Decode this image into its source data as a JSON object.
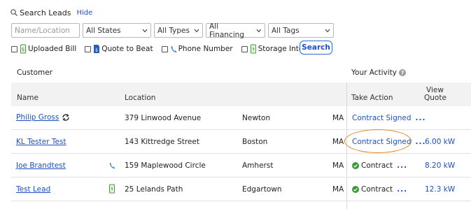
{
  "search": {
    "title": "Search Leads",
    "hide_label": "Hide",
    "name_location_placeholder": "Name/Location",
    "states_value": "All States",
    "types_value": "All Types",
    "financing_value": "All Financing",
    "tags_value": "All Tags",
    "button_label": "Search"
  },
  "checkboxes": {
    "uploaded_bill": "Uploaded Bill",
    "quote_to_beat": "Quote to Beat",
    "phone_number": "Phone Number",
    "storage_interest": "Storage Interest"
  },
  "sections": {
    "customer": "Customer",
    "your_activity": "Your Activity",
    "help_glyph": "?"
  },
  "table": {
    "headers": {
      "name": "Name",
      "location": "Location",
      "take_action": "Take Action",
      "view_quote_line1": "View",
      "view_quote_line2": "Quote"
    },
    "rows": [
      {
        "name": "Philip Gross",
        "address": "379 Linwood Avenue",
        "city": "Newton",
        "state": "MA",
        "action": "Contract Signed",
        "dots": "...",
        "quote": ""
      },
      {
        "name": "KL Tester Test",
        "address": "143 Kittredge Street",
        "city": "Boston",
        "state": "MA",
        "action": "Contract Signed",
        "dots": "...",
        "quote": "6.00 kW"
      },
      {
        "name": "Joe Brandtest",
        "address": "159 Maplewood Circle",
        "city": "Amherst",
        "state": "MA",
        "action": "Contract",
        "dots": "...",
        "quote": "8.20 kW"
      },
      {
        "name": "Test Lead",
        "address": "25 Lelands Path",
        "city": "Edgartown",
        "state": "MA",
        "action": "Contract",
        "dots": "...",
        "quote": "12.3 kW"
      }
    ]
  },
  "colors": {
    "link": "#1d4fc4",
    "highlight_oval": "#e8832a",
    "check_green": "#3a9a3a"
  }
}
